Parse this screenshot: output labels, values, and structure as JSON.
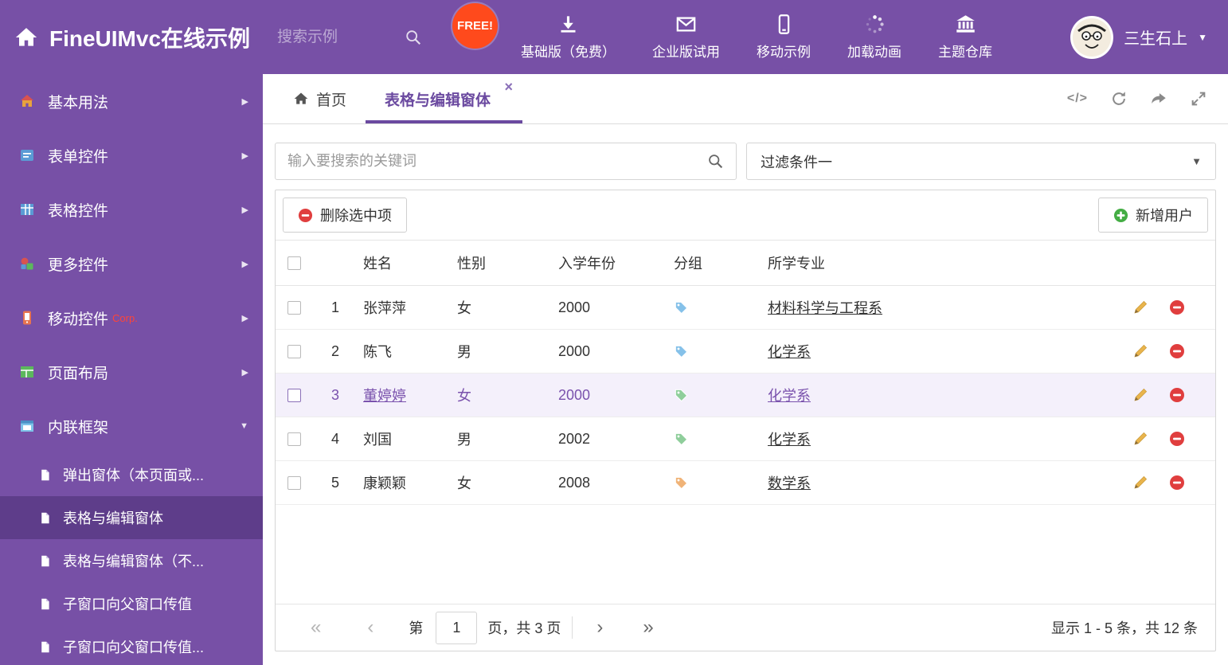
{
  "header": {
    "title": "FineUIMvc在线示例",
    "search_placeholder": "搜索示例",
    "free_badge": "FREE!",
    "nav_items": [
      {
        "label": "基础版（免费）",
        "icon": "download-icon"
      },
      {
        "label": "企业版试用",
        "icon": "envelope-icon"
      },
      {
        "label": "移动示例",
        "icon": "mobile-icon"
      },
      {
        "label": "加载动画",
        "icon": "spinner-icon"
      },
      {
        "label": "主题仓库",
        "icon": "bank-icon"
      }
    ],
    "user_name": "三生石上"
  },
  "sidebar": {
    "items": [
      {
        "label": "基本用法"
      },
      {
        "label": "表单控件"
      },
      {
        "label": "表格控件"
      },
      {
        "label": "更多控件"
      },
      {
        "label": "移动控件",
        "badge": "Corp."
      },
      {
        "label": "页面布局"
      },
      {
        "label": "内联框架"
      }
    ],
    "subitems": [
      {
        "label": "弹出窗体（本页面或..."
      },
      {
        "label": "表格与编辑窗体"
      },
      {
        "label": "表格与编辑窗体（不..."
      },
      {
        "label": "子窗口向父窗口传值"
      },
      {
        "label": "子窗口向父窗口传值..."
      }
    ]
  },
  "tabbar": {
    "home_tab": "首页",
    "active_tab": "表格与编辑窗体",
    "close_glyph": "×",
    "code_icon_text": "</>"
  },
  "filters": {
    "search_placeholder": "输入要搜索的关键词",
    "filter_selected": "过滤条件一"
  },
  "toolbar": {
    "delete_button": "删除选中项",
    "add_button": "新增用户"
  },
  "table": {
    "headers": {
      "name": "姓名",
      "gender": "性别",
      "year": "入学年份",
      "group": "分组",
      "major": "所学专业"
    },
    "rows": [
      {
        "num": "1",
        "name": "张萍萍",
        "gender": "女",
        "year": "2000",
        "tag_color": "#85C1E9",
        "major": "材料科学与工程系"
      },
      {
        "num": "2",
        "name": "陈飞",
        "gender": "男",
        "year": "2000",
        "tag_color": "#85C1E9",
        "major": "化学系"
      },
      {
        "num": "3",
        "name": "董婷婷",
        "gender": "女",
        "year": "2000",
        "tag_color": "#8FCE9B",
        "major": "化学系"
      },
      {
        "num": "4",
        "name": "刘国",
        "gender": "男",
        "year": "2002",
        "tag_color": "#8FCE9B",
        "major": "化学系"
      },
      {
        "num": "5",
        "name": "康颖颖",
        "gender": "女",
        "year": "2008",
        "tag_color": "#F0B377",
        "major": "数学系"
      }
    ]
  },
  "pagination": {
    "first": "«",
    "prev": "‹",
    "page_label_before": "第",
    "current_page": "1",
    "page_label_after": "页，共 3 页",
    "next": "›",
    "last": "»",
    "summary": "显示 1 - 5 条，共 12 条"
  },
  "colors": {
    "purple_main": "#7750A6",
    "purple_dark": "#5E3D8A",
    "tab_accent": "#6B4AA0",
    "selected_row_bg": "#F4F0FB",
    "free_badge_bg": "#FF4A1C",
    "delete_red": "#E03E3E",
    "add_green": "#44AD44",
    "pencil_gold": "#E9B44C"
  }
}
